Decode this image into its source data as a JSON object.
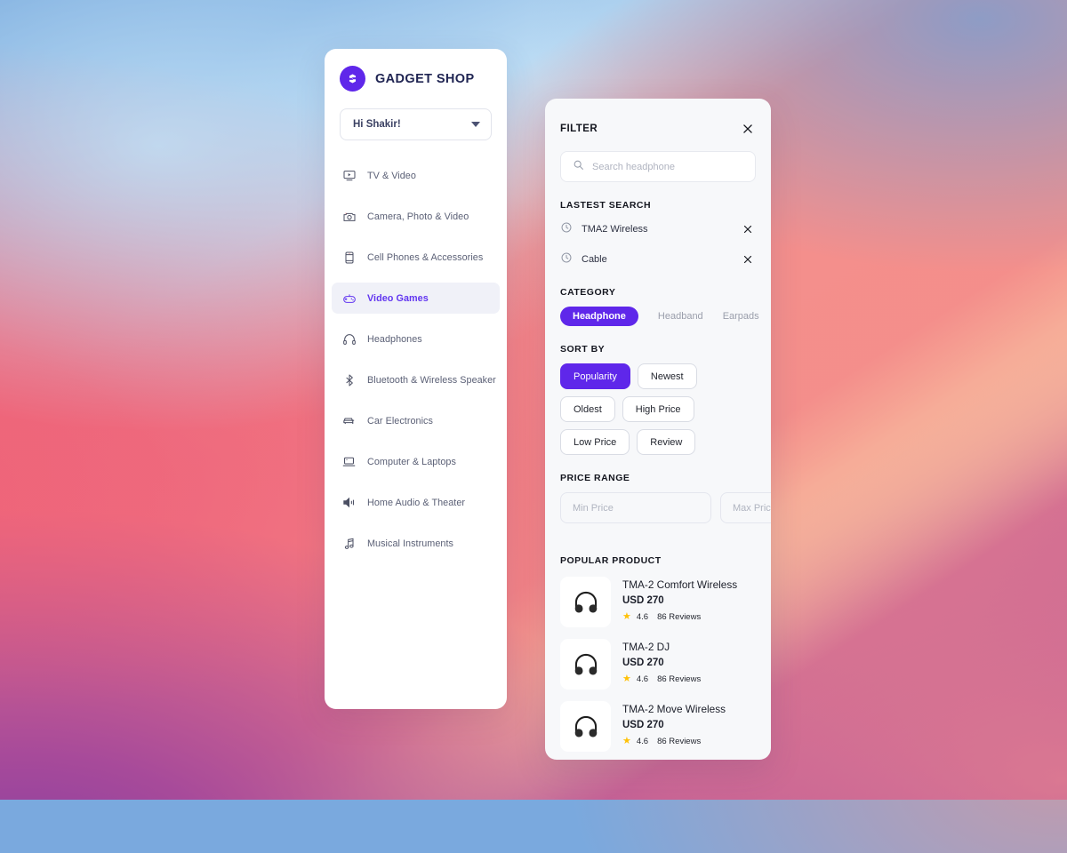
{
  "sidebar": {
    "brand": {
      "name": "GADGET SHOP",
      "logo_icon": "gadget-logo-icon",
      "logo_color": "#5f27ea"
    },
    "user_select": {
      "label": "Hi Shakir!",
      "caret_icon": "chevron-down-icon"
    },
    "items": [
      {
        "label": "TV & Video",
        "icon": "tv-icon",
        "active": false
      },
      {
        "label": "Camera, Photo & Video",
        "icon": "camera-icon",
        "active": false
      },
      {
        "label": "Cell Phones & Accessories",
        "icon": "phone-icon",
        "active": false
      },
      {
        "label": "Video Games",
        "icon": "gamepad-robot-icon",
        "active": true
      },
      {
        "label": "Headphones",
        "icon": "headphones-icon",
        "active": false
      },
      {
        "label": "Bluetooth & Wireless Speaker",
        "icon": "bluetooth-icon",
        "active": false
      },
      {
        "label": "Car Electronics",
        "icon": "car-icon",
        "active": false
      },
      {
        "label": "Computer & Laptops",
        "icon": "laptop-icon",
        "active": false
      },
      {
        "label": "Home Audio & Theater",
        "icon": "speaker-volume-icon",
        "active": false
      },
      {
        "label": "Musical Instruments",
        "icon": "music-note-icon",
        "active": false
      }
    ]
  },
  "filter": {
    "title": "FILTER",
    "close_icon": "close-icon",
    "search": {
      "placeholder": "Search headphone",
      "value": "",
      "icon": "search-icon"
    },
    "latest_search": {
      "title": "LASTEST SEARCH",
      "items": [
        {
          "label": "TMA2 Wireless",
          "icon": "clock-icon",
          "remove_icon": "close-icon"
        },
        {
          "label": "Cable",
          "icon": "clock-icon",
          "remove_icon": "close-icon"
        }
      ]
    },
    "category": {
      "title": "CATEGORY",
      "options": [
        {
          "label": "Headphone",
          "selected": true
        },
        {
          "label": "Headband",
          "selected": false
        },
        {
          "label": "Earpads",
          "selected": false
        }
      ]
    },
    "sort_by": {
      "title": "SORT BY",
      "options": [
        {
          "label": "Popularity",
          "selected": true
        },
        {
          "label": "Newest",
          "selected": false
        },
        {
          "label": "Oldest",
          "selected": false
        },
        {
          "label": "High Price",
          "selected": false
        },
        {
          "label": "Low Price",
          "selected": false
        },
        {
          "label": "Review",
          "selected": false
        }
      ]
    },
    "price_range": {
      "title": "PRICE RANGE",
      "min": {
        "placeholder": "Min Price",
        "value": ""
      },
      "max": {
        "placeholder": "Max Price",
        "value": ""
      }
    },
    "popular_product": {
      "title": "POPULAR PRODUCT",
      "items": [
        {
          "name": "TMA-2 Comfort Wireless",
          "price": "USD 270",
          "rating": "4.6",
          "reviews": "86 Reviews",
          "thumb_icon": "headphones-product-icon"
        },
        {
          "name": "TMA-2 DJ",
          "price": "USD 270",
          "rating": "4.6",
          "reviews": "86 Reviews",
          "thumb_icon": "headphones-product-icon"
        },
        {
          "name": "TMA-2 Move Wireless",
          "price": "USD 270",
          "rating": "4.6",
          "reviews": "86 Reviews",
          "thumb_icon": "headphones-product-icon"
        }
      ]
    }
  },
  "theme": {
    "accent": "#5f27ea",
    "active_nav_bg": "#f0f1f8",
    "active_nav_text": "#6236f0",
    "star_color": "#ffc107",
    "panel_bg": "#f7f8fa",
    "card_bg": "#ffffff"
  }
}
